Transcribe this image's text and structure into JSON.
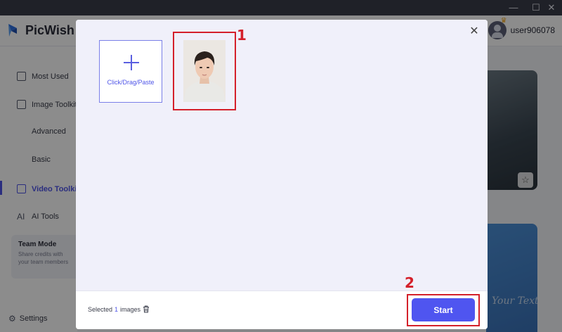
{
  "app": {
    "name": "PicWish",
    "username": "user906078"
  },
  "window_controls": {
    "minimize": "—",
    "maximize": "☐",
    "close": "✕"
  },
  "sidebar": {
    "items": [
      {
        "label": "Most Used"
      },
      {
        "label": "Image Toolkit"
      },
      {
        "label": "Advanced"
      },
      {
        "label": "Basic"
      },
      {
        "label": "Video Toolkit"
      },
      {
        "label": "AI Tools"
      }
    ],
    "team_mode": {
      "title": "Team Mode",
      "description": "Share credits with your team members"
    },
    "settings_label": "Settings"
  },
  "modal": {
    "add_tile_label": "Click/Drag/Paste",
    "selected_prefix": "Selected",
    "selected_count": "1",
    "selected_suffix": "images",
    "start_label": "Start"
  },
  "annotations": {
    "callout_1": "1",
    "callout_2": "2"
  },
  "background": {
    "stamp_text": "Your Text"
  },
  "colors": {
    "accent": "#4f55f0",
    "highlight_red": "#d4202a"
  }
}
